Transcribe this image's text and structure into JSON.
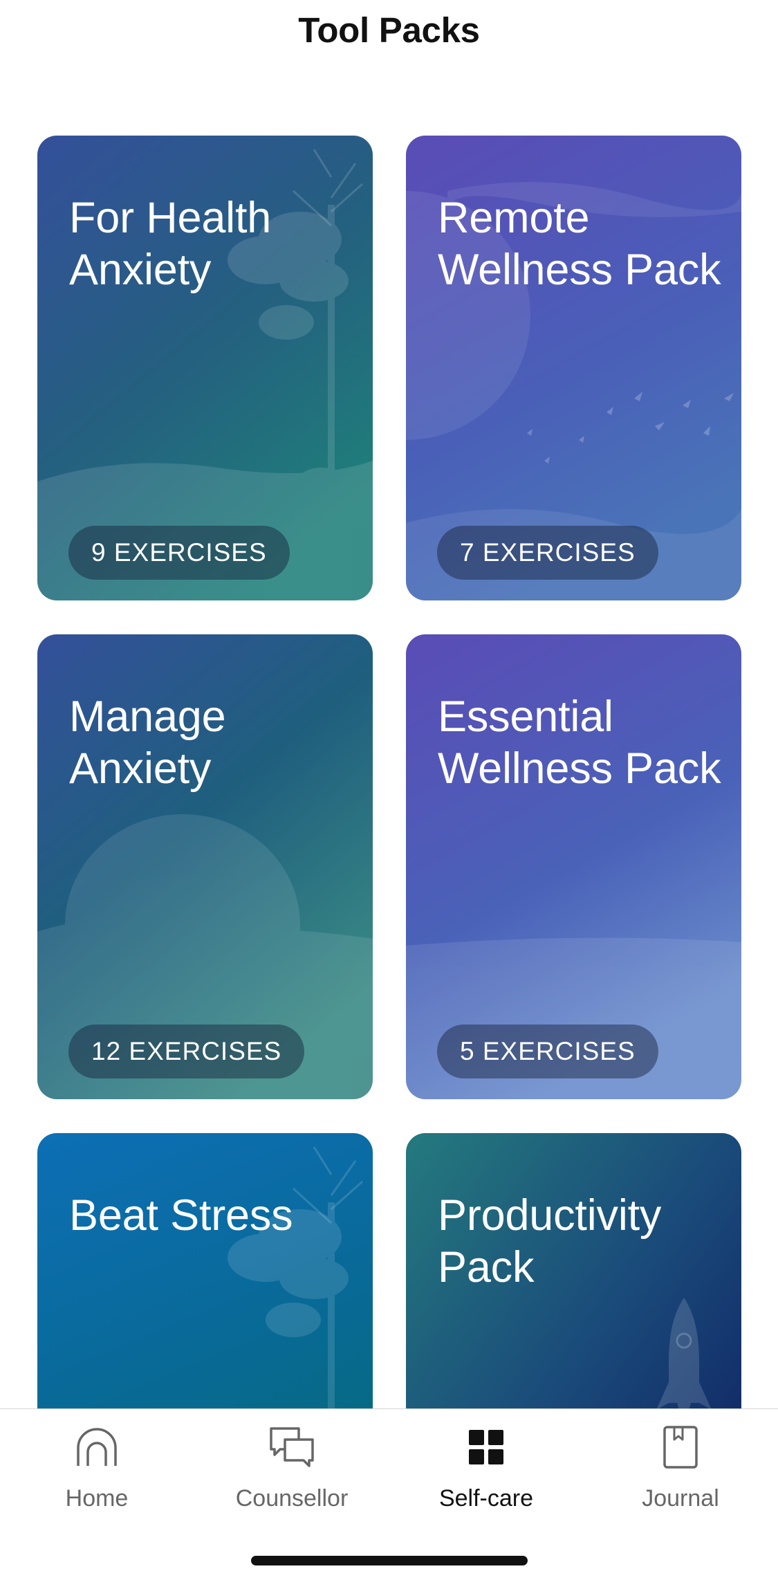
{
  "header": {
    "title": "Tool Packs"
  },
  "cards": [
    {
      "title": "For Health\nAnxiety",
      "badge": "9 EXERCISES"
    },
    {
      "title": "Remote\nWellness Pack",
      "badge": "7 EXERCISES"
    },
    {
      "title": "Manage\nAnxiety",
      "badge": "12 EXERCISES"
    },
    {
      "title": "Essential\nWellness Pack",
      "badge": "5 EXERCISES"
    },
    {
      "title": "Beat Stress",
      "badge": ""
    },
    {
      "title": "Productivity\nPack",
      "badge": ""
    }
  ],
  "tabbar": {
    "items": [
      {
        "label": "Home",
        "icon": "home-icon",
        "active": false
      },
      {
        "label": "Counsellor",
        "icon": "chat-bubbles-icon",
        "active": false
      },
      {
        "label": "Self-care",
        "icon": "grid-icon",
        "active": true
      },
      {
        "label": "Journal",
        "icon": "journal-icon",
        "active": false
      }
    ]
  },
  "colors": {
    "teal_blue": "#2f4f8f",
    "purple": "#5a4fb8",
    "stress_blue": "#0b6fae",
    "productivity_navy": "#13235f",
    "tab_active": "#111111",
    "tab_inactive": "#666666"
  }
}
